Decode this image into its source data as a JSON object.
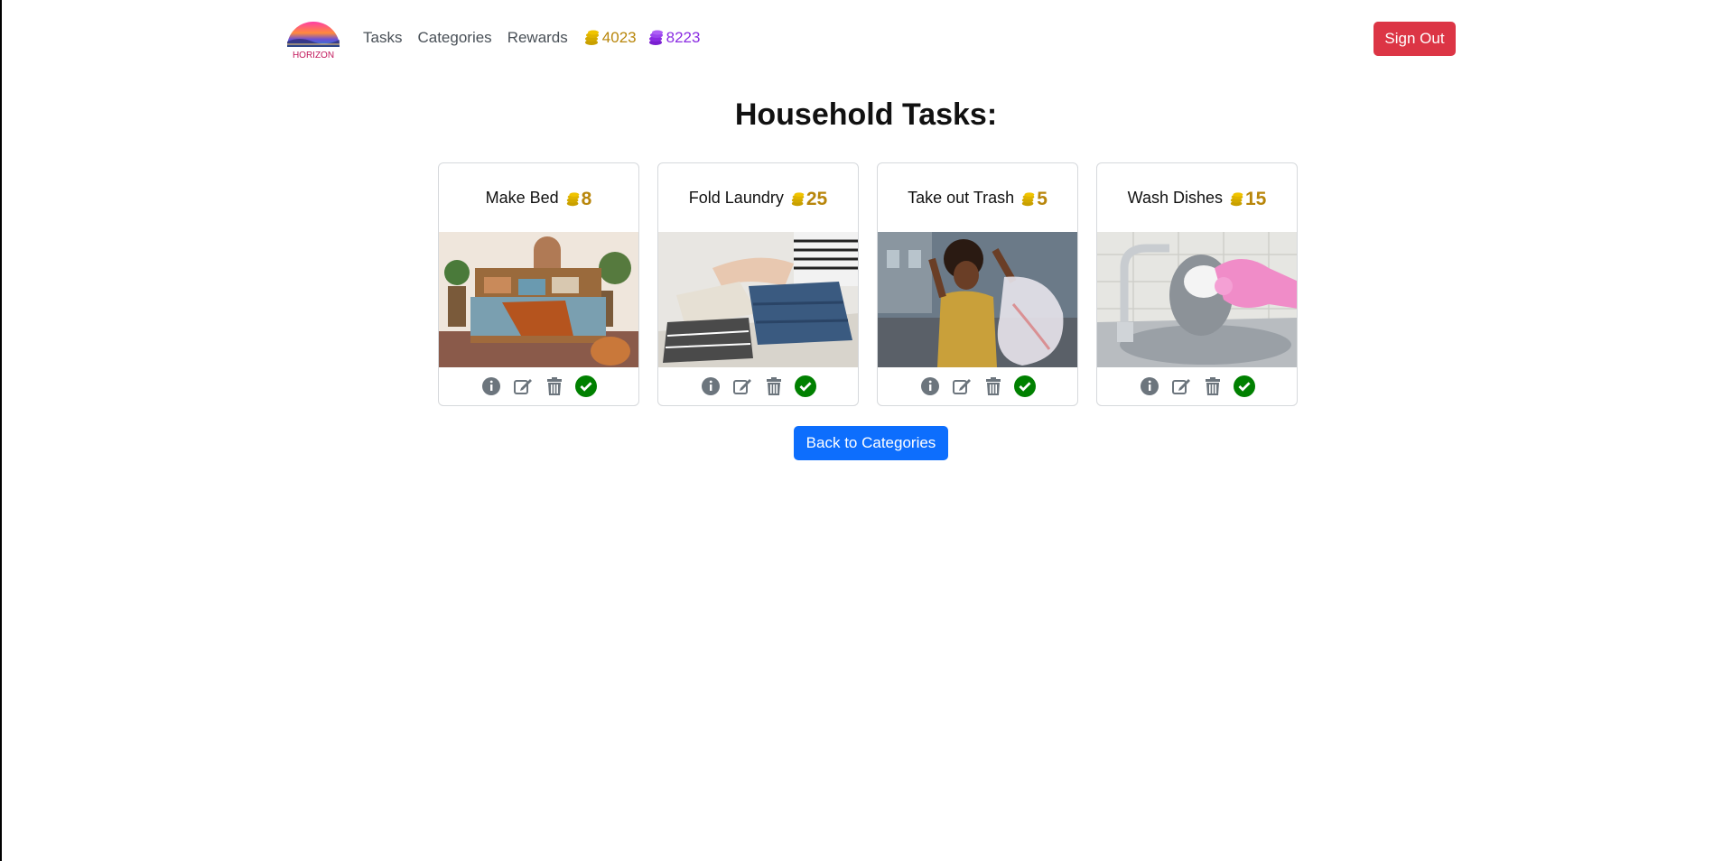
{
  "nav": {
    "logo_text": "HORIZON",
    "links": [
      "Tasks",
      "Categories",
      "Rewards"
    ],
    "gold_coins": "4023",
    "purple_coins": "8223",
    "signout_label": "Sign Out"
  },
  "page": {
    "title": "Household Tasks:"
  },
  "tasks": [
    {
      "title": "Make Bed",
      "points": "8"
    },
    {
      "title": "Fold Laundry",
      "points": "25"
    },
    {
      "title": "Take out Trash",
      "points": "5"
    },
    {
      "title": "Wash Dishes",
      "points": "15"
    }
  ],
  "actions": {
    "icons": [
      "info-icon",
      "edit-icon",
      "trash-icon",
      "check-circle-icon"
    ]
  },
  "back_button_label": "Back to Categories",
  "colors": {
    "gold": "#b8860b",
    "purple": "#8a2be2",
    "danger": "#dc3545",
    "primary": "#0d6efd",
    "success": "#008000"
  }
}
